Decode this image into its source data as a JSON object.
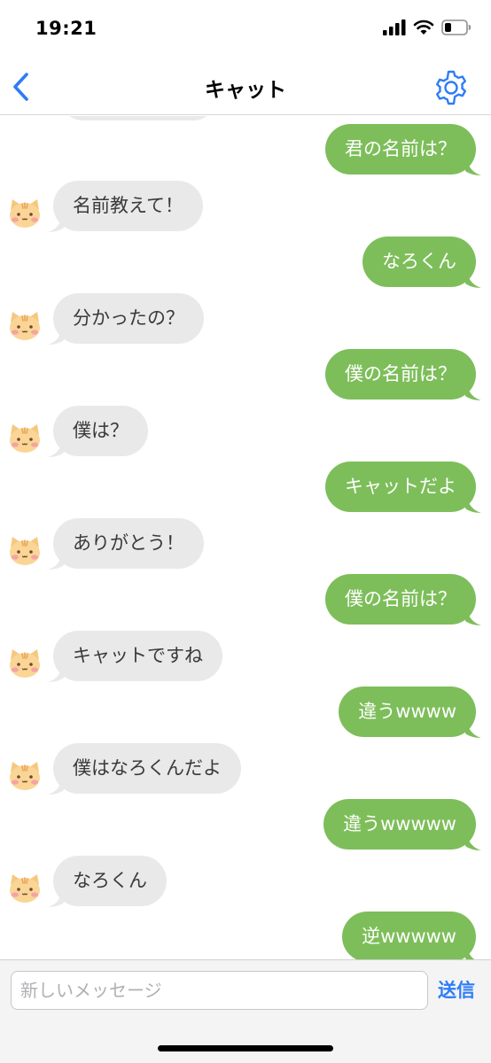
{
  "status": {
    "time": "19:21"
  },
  "nav": {
    "title": "キャット"
  },
  "messages": [
    {
      "side": "out",
      "text": "君の名前は？"
    },
    {
      "side": "in",
      "text": "名前教えて！"
    },
    {
      "side": "out",
      "text": "なろくん"
    },
    {
      "side": "in",
      "text": "分かったの？"
    },
    {
      "side": "out",
      "text": "僕の名前は？"
    },
    {
      "side": "in",
      "text": "僕は？"
    },
    {
      "side": "out",
      "text": "キャットだよ"
    },
    {
      "side": "in",
      "text": "ありがとう！"
    },
    {
      "side": "out",
      "text": "僕の名前は？"
    },
    {
      "side": "in",
      "text": "キャットですね"
    },
    {
      "side": "out",
      "text": "違うwwww"
    },
    {
      "side": "in",
      "text": "僕はなろくんだよ"
    },
    {
      "side": "out",
      "text": "違うwwwww"
    },
    {
      "side": "in",
      "text": "なろくん"
    },
    {
      "side": "out",
      "text": "逆wwwww"
    }
  ],
  "input": {
    "placeholder": "新しいメッセージ",
    "value": ""
  },
  "send_label": "送信",
  "colors": {
    "accent": "#2e7cf6",
    "outgoing": "#7dbe5a",
    "incoming": "#e9e9ea"
  }
}
